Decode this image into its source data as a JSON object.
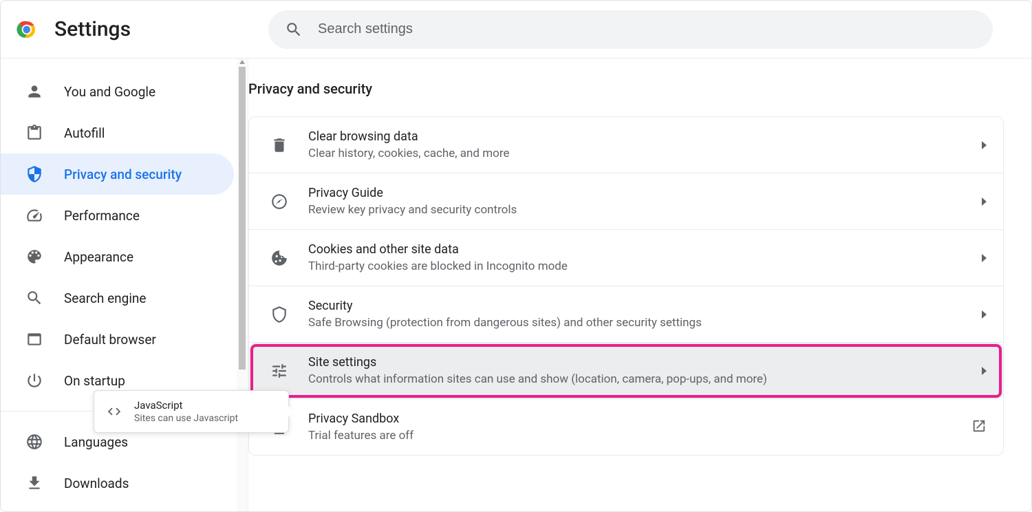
{
  "header": {
    "title": "Settings",
    "search_placeholder": "Search settings"
  },
  "sidebar": {
    "items": [
      {
        "icon": "person",
        "label": "You and Google"
      },
      {
        "icon": "clipboard",
        "label": "Autofill"
      },
      {
        "icon": "shield",
        "label": "Privacy and security",
        "active": true
      },
      {
        "icon": "speedometer",
        "label": "Performance"
      },
      {
        "icon": "palette",
        "label": "Appearance"
      },
      {
        "icon": "search",
        "label": "Search engine"
      },
      {
        "icon": "browser",
        "label": "Default browser"
      },
      {
        "icon": "power",
        "label": "On startup"
      }
    ],
    "items2": [
      {
        "icon": "globe",
        "label": "Languages"
      },
      {
        "icon": "download",
        "label": "Downloads"
      }
    ]
  },
  "main": {
    "title": "Privacy and security",
    "rows": [
      {
        "icon": "trash",
        "title": "Clear browsing data",
        "subtitle": "Clear history, cookies, cache, and more",
        "arrow": true
      },
      {
        "icon": "compass",
        "title": "Privacy Guide",
        "subtitle": "Review key privacy and security controls",
        "arrow": true
      },
      {
        "icon": "cookie",
        "title": "Cookies and other site data",
        "subtitle": "Third-party cookies are blocked in Incognito mode",
        "arrow": true
      },
      {
        "icon": "shield-outline",
        "title": "Security",
        "subtitle": "Safe Browsing (protection from dangerous sites) and other security settings",
        "arrow": true
      },
      {
        "icon": "sliders",
        "title": "Site settings",
        "subtitle": "Controls what information sites can use and show (location, camera, pop-ups, and more)",
        "arrow": true,
        "highlighted": true
      },
      {
        "icon": "flask",
        "title": "Privacy Sandbox",
        "subtitle": "Trial features are off",
        "openext": true
      }
    ]
  },
  "tooltip": {
    "title": "JavaScript",
    "subtitle": "Sites can use Javascript"
  },
  "colors": {
    "accent": "#1a73e8",
    "highlight_border": "#e91e8c"
  }
}
